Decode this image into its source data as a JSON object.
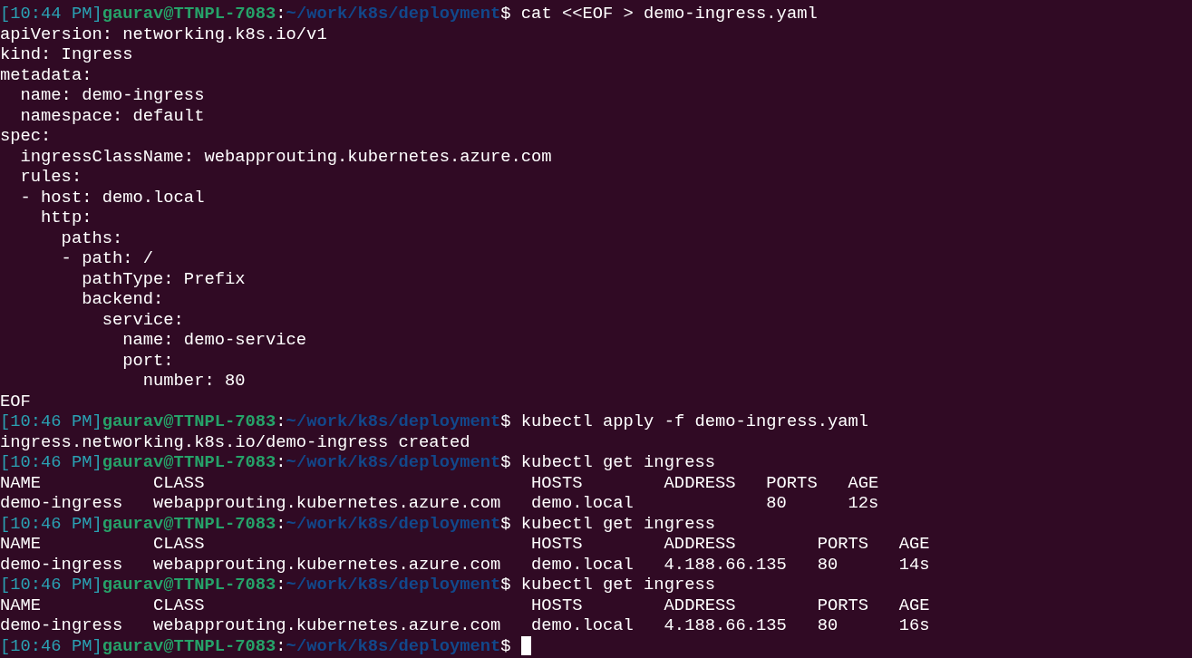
{
  "terminal": {
    "cursor": true,
    "lines": [
      {
        "kind": "prompt",
        "time": "[10:44 PM]",
        "user": "gaurav@TTNPL-7083",
        "sep": ":",
        "path": "~/work/k8s/deployment",
        "symbol": "$",
        "command": "cat <<EOF > demo-ingress.yaml"
      },
      {
        "kind": "output",
        "text": "apiVersion: networking.k8s.io/v1"
      },
      {
        "kind": "output",
        "text": "kind: Ingress"
      },
      {
        "kind": "output",
        "text": "metadata:"
      },
      {
        "kind": "output",
        "text": "  name: demo-ingress"
      },
      {
        "kind": "output",
        "text": "  namespace: default"
      },
      {
        "kind": "output",
        "text": "spec:"
      },
      {
        "kind": "output",
        "text": "  ingressClassName: webapprouting.kubernetes.azure.com"
      },
      {
        "kind": "output",
        "text": "  rules:"
      },
      {
        "kind": "output",
        "text": "  - host: demo.local"
      },
      {
        "kind": "output",
        "text": "    http:"
      },
      {
        "kind": "output",
        "text": "      paths:"
      },
      {
        "kind": "output",
        "text": "      - path: /"
      },
      {
        "kind": "output",
        "text": "        pathType: Prefix"
      },
      {
        "kind": "output",
        "text": "        backend:"
      },
      {
        "kind": "output",
        "text": "          service:"
      },
      {
        "kind": "output",
        "text": "            name: demo-service"
      },
      {
        "kind": "output",
        "text": "            port:"
      },
      {
        "kind": "output",
        "text": "              number: 80"
      },
      {
        "kind": "output",
        "text": "EOF"
      },
      {
        "kind": "prompt",
        "time": "[10:46 PM]",
        "user": "gaurav@TTNPL-7083",
        "sep": ":",
        "path": "~/work/k8s/deployment",
        "symbol": "$",
        "command": "kubectl apply -f demo-ingress.yaml"
      },
      {
        "kind": "output",
        "text": "ingress.networking.k8s.io/demo-ingress created"
      },
      {
        "kind": "prompt",
        "time": "[10:46 PM]",
        "user": "gaurav@TTNPL-7083",
        "sep": ":",
        "path": "~/work/k8s/deployment",
        "symbol": "$",
        "command": "kubectl get ingress"
      },
      {
        "kind": "output",
        "text": "NAME           CLASS                                HOSTS        ADDRESS   PORTS   AGE"
      },
      {
        "kind": "output",
        "text": "demo-ingress   webapprouting.kubernetes.azure.com   demo.local             80      12s"
      },
      {
        "kind": "prompt",
        "time": "[10:46 PM]",
        "user": "gaurav@TTNPL-7083",
        "sep": ":",
        "path": "~/work/k8s/deployment",
        "symbol": "$",
        "command": "kubectl get ingress"
      },
      {
        "kind": "output",
        "text": "NAME           CLASS                                HOSTS        ADDRESS        PORTS   AGE"
      },
      {
        "kind": "output",
        "text": "demo-ingress   webapprouting.kubernetes.azure.com   demo.local   4.188.66.135   80      14s"
      },
      {
        "kind": "prompt",
        "time": "[10:46 PM]",
        "user": "gaurav@TTNPL-7083",
        "sep": ":",
        "path": "~/work/k8s/deployment",
        "symbol": "$",
        "command": "kubectl get ingress"
      },
      {
        "kind": "output",
        "text": "NAME           CLASS                                HOSTS        ADDRESS        PORTS   AGE"
      },
      {
        "kind": "output",
        "text": "demo-ingress   webapprouting.kubernetes.azure.com   demo.local   4.188.66.135   80      16s"
      },
      {
        "kind": "prompt",
        "time": "[10:46 PM]",
        "user": "gaurav@TTNPL-7083",
        "sep": ":",
        "path": "~/work/k8s/deployment",
        "symbol": "$"
      }
    ]
  }
}
